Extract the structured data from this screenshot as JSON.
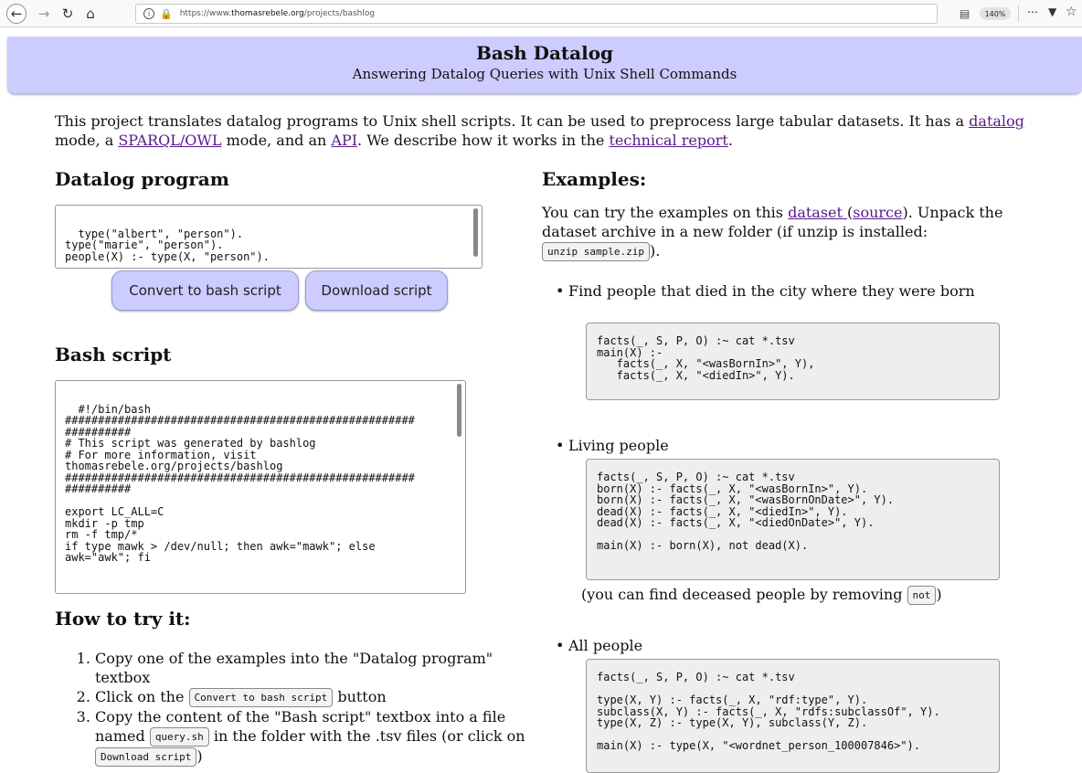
{
  "browser": {
    "url_prefix": "https://www.",
    "url_domain": "thomasrebele.org",
    "url_path": "/projects/bashlog",
    "zoom": "140%"
  },
  "header": {
    "title": "Bash Datalog",
    "subtitle": "Answering Datalog Queries with Unix Shell Commands"
  },
  "intro": {
    "t1": "This project translates datalog programs to Unix shell scripts. It can be used to preprocess large tabular datasets. It has a ",
    "link_datalog": "datalog",
    "t2": " mode, a ",
    "link_sparql": "SPARQL/OWL",
    "t3": " mode, and an ",
    "link_api": "API",
    "t4": ". We describe how it works in the ",
    "link_report": "technical report",
    "t5": "."
  },
  "datalog": {
    "heading": "Datalog program",
    "program": "type(\"albert\", \"person\").\ntype(\"marie\", \"person\").\npeople(X) :- type(X, \"person\").",
    "convert_label": "Convert to bash script",
    "download_label": "Download script"
  },
  "bash": {
    "heading": "Bash script",
    "script": "#!/bin/bash\n#####################################################\n##########\n# This script was generated by bashlog\n# For more information, visit\nthomasrebele.org/projects/bashlog\n#####################################################\n##########\n\nexport LC_ALL=C\nmkdir -p tmp\nrm -f tmp/*\nif type mawk > /dev/null; then awk=\"mawk\"; else\nawk=\"awk\"; fi"
  },
  "howto": {
    "heading": "How to try it:",
    "step1": "Copy one of the examples into the \"Datalog program\" textbox",
    "step2_a": "Click on the ",
    "step2_code": "Convert to bash script",
    "step2_b": " button",
    "step3_a": "Copy the content of the \"Bash script\" textbox into a file named ",
    "step3_code1": "query.sh",
    "step3_b": " in the folder with the .tsv files (or click on ",
    "step3_code2": "Download script",
    "step3_c": ")"
  },
  "examples": {
    "heading": "Examples:",
    "intro_a": "You can try the examples on this ",
    "link_dataset": "dataset ",
    "intro_b": "(",
    "link_source": "source",
    "intro_c": "). Unpack the dataset archive in a new folder (if unzip is installed: ",
    "unzip_code": "unzip sample.zip",
    "intro_d": ").",
    "ex1_title": "Find people that died in the city where they were born",
    "ex1_code": "facts(_, S, P, O) :~ cat *.tsv\nmain(X) :-\n   facts(_, X, \"<wasBornIn>\", Y),\n   facts(_, X, \"<diedIn>\", Y).",
    "ex2_title": "Living people",
    "ex2_code": "facts(_, S, P, O) :~ cat *.tsv\nborn(X) :- facts(_, X, \"<wasBornIn>\", Y).\nborn(X) :- facts(_, X, \"<wasBornOnDate>\", Y).\ndead(X) :- facts(_, X, \"<diedIn>\", Y).\ndead(X) :- facts(_, X, \"<diedOnDate>\", Y).\n\nmain(X) :- born(X), not dead(X).",
    "deceased_a": "(you can find deceased people by removing ",
    "deceased_code": "not",
    "deceased_b": ")",
    "ex3_title": "All people",
    "ex3_code": "facts(_, S, P, O) :~ cat *.tsv\n\ntype(X, Y) :- facts(_, X, \"rdf:type\", Y).\nsubclass(X, Y) :- facts(_, X, \"rdfs:subclassOf\", Y).\ntype(X, Z) :- type(X, Y), subclass(Y, Z).\n\nmain(X) :- type(X, \"<wordnet_person_100007846>\")."
  }
}
